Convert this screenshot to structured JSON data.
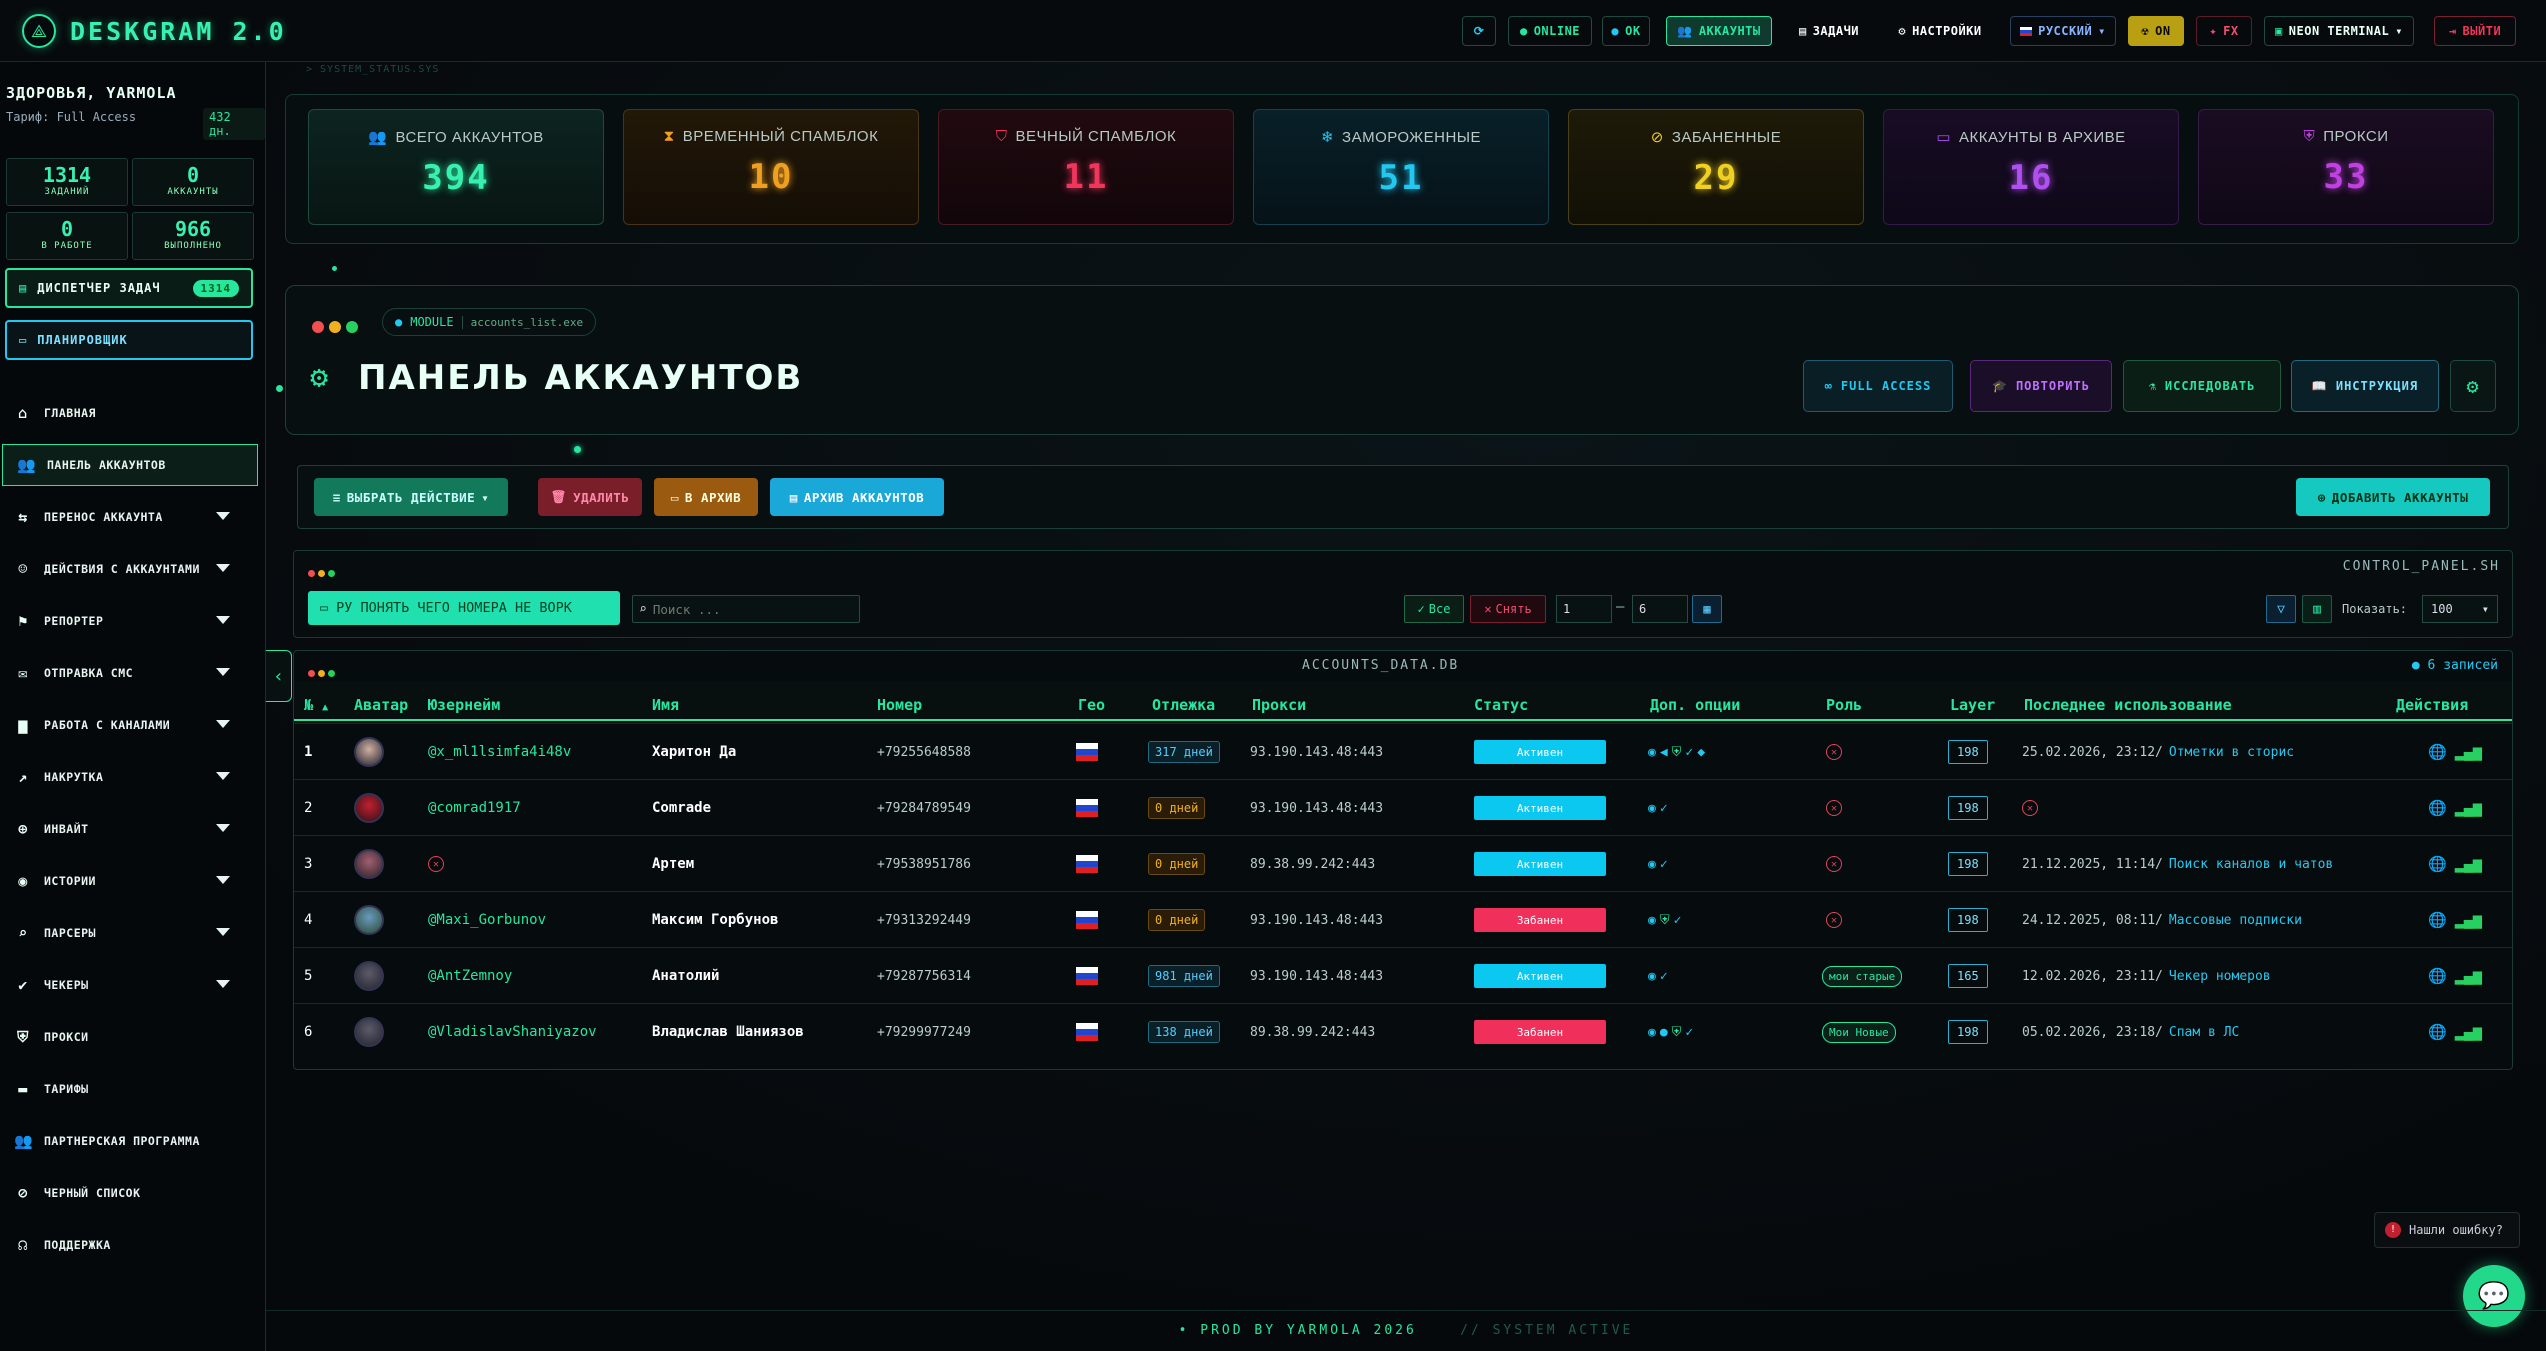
{
  "app": {
    "title": "DESKGRAM 2.0"
  },
  "topbar": {
    "items": [
      {
        "label": "",
        "icon": "refresh-icon"
      },
      {
        "label": "ONLINE"
      },
      {
        "label": "OK"
      },
      {
        "label": "АККАУНТЫ"
      },
      {
        "label": "ЗАДАЧИ"
      },
      {
        "label": "НАСТРОЙКИ"
      },
      {
        "label": "РУССКИЙ"
      },
      {
        "label": "ON"
      },
      {
        "label": "FX"
      },
      {
        "label": "NEON TERMINAL"
      },
      {
        "label": "ВЫЙТИ"
      }
    ]
  },
  "sidebar": {
    "greeting": "ЗДОРОВЬЯ, YARMOLA",
    "tariff": "Тариф: Full Access",
    "days": "432 дн.",
    "stats": [
      {
        "value": "1314",
        "label": "ЗАДАНИЙ"
      },
      {
        "value": "0",
        "label": "АККАУНТЫ"
      },
      {
        "value": "0",
        "label": "В РАБОТЕ"
      },
      {
        "value": "966",
        "label": "ВЫПОЛНЕНО"
      }
    ],
    "dispatcher": {
      "label": "ДИСПЕТЧЕР ЗАДАЧ",
      "count": "1314"
    },
    "planner": "ПЛАНИРОВЩИК",
    "items": [
      {
        "label": "ГЛАВНАЯ"
      },
      {
        "label": "ПАНЕЛЬ АККАУНТОВ"
      },
      {
        "label": "ПЕРЕНОС АККАУНТА"
      },
      {
        "label": "ДЕЙСТВИЯ С АККАУНТАМИ"
      },
      {
        "label": "РЕПОРТЕР"
      },
      {
        "label": "ОТПРАВКА СМС"
      },
      {
        "label": "РАБОТА С КАНАЛАМИ"
      },
      {
        "label": "НАКРУТКА"
      },
      {
        "label": "ИНВАЙТ"
      },
      {
        "label": "ИСТОРИИ"
      },
      {
        "label": "ПАРСЕРЫ"
      },
      {
        "label": "ЧЕКЕРЫ"
      },
      {
        "label": "ПРОКСИ"
      },
      {
        "label": "ТАРИФЫ"
      },
      {
        "label": "ПАРТНЕРСКАЯ ПРОГРАММА"
      },
      {
        "label": "ЧЕРНЫЙ СПИСОК"
      },
      {
        "label": "ПОДДЕРЖКА"
      }
    ]
  },
  "breadcrumb": "> SYSTEM_STATUS.SYS",
  "stat_cards": [
    {
      "title": "ВСЕГО АККАУНТОВ",
      "value": "394",
      "color": "#27e6a0"
    },
    {
      "title": "ВРЕМЕННЫЙ СПАМБЛОК",
      "value": "10",
      "color": "#f0a020"
    },
    {
      "title": "ВЕЧНЫЙ СПАМБЛОК",
      "value": "11",
      "color": "#f0365a"
    },
    {
      "title": "ЗАМОРОЖЕННЫЕ",
      "value": "51",
      "color": "#22c8f0"
    },
    {
      "title": "ЗАБАНЕННЫЕ",
      "value": "29",
      "color": "#f0d020"
    },
    {
      "title": "АККАУНТЫ В АРХИВЕ",
      "value": "16",
      "color": "#b050f0"
    },
    {
      "title": "ПРОКСИ",
      "value": "33",
      "color": "#c040e0"
    }
  ],
  "panel": {
    "module": "MODULE",
    "module_file": "accounts_list.exe",
    "title": "ПАНЕЛЬ АККАУНТОВ",
    "buttons": {
      "full": "FULL ACCESS",
      "repeat": "ПОВТОРИТЬ",
      "explore": "ИССЛЕДОВАТЬ",
      "guide": "ИНСТРУКЦИЯ"
    }
  },
  "actions": {
    "select": "ВЫБРАТЬ ДЕЙСТВИЕ",
    "delete": "УДАЛИТЬ",
    "to_archive": "В АРХИВ",
    "archive": "АРХИВ АККАУНТОВ",
    "add": "ДОБАВИТЬ АККАУНТЫ"
  },
  "control": {
    "filename": "CONTROL_PANEL.SH",
    "filter_btn": "РУ ПОНЯТЬ ЧЕГО НОМЕРА НЕ ВОРК",
    "search_placeholder": "Поиск ...",
    "all": "Все",
    "unselect": "Снять",
    "from": "1",
    "to": "6",
    "show_label": "Показать:",
    "show_value": "100"
  },
  "table": {
    "filename": "ACCOUNTS_DATA.DB",
    "records": "6 записей",
    "headers": [
      "№",
      "Аватар",
      "Юзернейм",
      "Имя",
      "Номер",
      "Гео",
      "Отлежка",
      "Прокси",
      "Статус",
      "Доп. опции",
      "Роль",
      "Layer",
      "Последнее использование",
      "Действия"
    ],
    "rows": [
      {
        "n": "1",
        "user": "@x_ml1lsimfa4i48v",
        "name": "Харитон Да",
        "phone": "+79255648588",
        "age": "317 дней",
        "age_kind": "blue",
        "proxy": "93.190.143.48:443",
        "status": "Активен",
        "role": "",
        "layer": "198",
        "last_date": "25.02.2026, 23:12/",
        "last_task": "Отметки в сторис"
      },
      {
        "n": "2",
        "user": "@comrad1917",
        "name": "Comrade",
        "phone": "+79284789549",
        "age": "0 дней",
        "age_kind": "orange",
        "proxy": "93.190.143.48:443",
        "status": "Активен",
        "role": "",
        "layer": "198",
        "last_date": "",
        "last_task": ""
      },
      {
        "n": "3",
        "user": "",
        "name": "Артем",
        "phone": "+79538951786",
        "age": "0 дней",
        "age_kind": "orange",
        "proxy": "89.38.99.242:443",
        "status": "Активен",
        "role": "",
        "layer": "198",
        "last_date": "21.12.2025, 11:14/",
        "last_task": "Поиск каналов и чатов"
      },
      {
        "n": "4",
        "user": "@Maxi_Gorbunov",
        "name": "Максим Горбунов",
        "phone": "+79313292449",
        "age": "0 дней",
        "age_kind": "orange",
        "proxy": "93.190.143.48:443",
        "status": "Забанен",
        "role": "",
        "layer": "198",
        "last_date": "24.12.2025, 08:11/",
        "last_task": "Массовые подписки"
      },
      {
        "n": "5",
        "user": "@AntZemnoy",
        "name": "Анатолий",
        "phone": "+79287756314",
        "age": "981 дней",
        "age_kind": "blue",
        "proxy": "93.190.143.48:443",
        "status": "Активен",
        "role": "мои старые",
        "layer": "165",
        "last_date": "12.02.2026, 23:11/",
        "last_task": "Чекер номеров"
      },
      {
        "n": "6",
        "user": "@VladislavShaniyazov",
        "name": "Владислав Шаниязов",
        "phone": "+79299977249",
        "age": "138 дней",
        "age_kind": "blue",
        "proxy": "89.38.99.242:443",
        "status": "Забанен",
        "role": "Мои Новые",
        "layer": "198",
        "last_date": "05.02.2026, 23:18/",
        "last_task": "Спам в ЛС"
      }
    ]
  },
  "bug_report": "Нашли ошибку?",
  "footer": {
    "left": "• PROD BY YARMOLA 2026",
    "right": "// SYSTEM ACTIVE"
  }
}
